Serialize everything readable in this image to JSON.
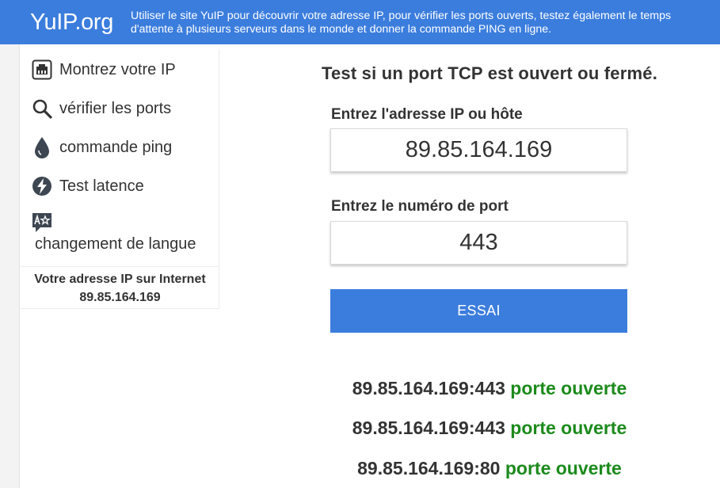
{
  "header": {
    "logo": "YuIP.org",
    "description": "Utiliser le site YuIP pour découvrir votre adresse IP, pour vérifier les ports ouverts, testez également le temps d'attente à plusieurs serveurs dans le monde et donner la commande PING en ligne.",
    "background_color": "#3b7ddd"
  },
  "sidebar": {
    "items": [
      {
        "label": "Montrez votre IP",
        "icon": "ip-card-icon"
      },
      {
        "label": "vérifier les ports",
        "icon": "search-icon"
      },
      {
        "label": "commande ping",
        "icon": "drop-icon"
      },
      {
        "label": "Test latence",
        "icon": "lightning-icon"
      },
      {
        "label": "changement de langue",
        "icon": "translate-icon"
      }
    ],
    "ip_box": {
      "title": "Votre adresse IP sur Internet",
      "ip": "89.85.164.169"
    }
  },
  "main": {
    "title": "Test si un port TCP est ouvert ou fermé.",
    "host_label": "Entrez l'adresse IP ou hôte",
    "host_value": "89.85.164.169",
    "port_label": "Entrez le numéro de port",
    "port_value": "443",
    "button_label": "ESSAI",
    "button_color": "#3b7ddd",
    "results": [
      {
        "address": "89.85.164.169:443",
        "status": "porte ouverte"
      },
      {
        "address": "89.85.164.169:443",
        "status": "porte ouverte"
      },
      {
        "address": "89.85.164.169:80",
        "status": "porte ouverte"
      }
    ],
    "status_color": "#1c8a1c"
  }
}
